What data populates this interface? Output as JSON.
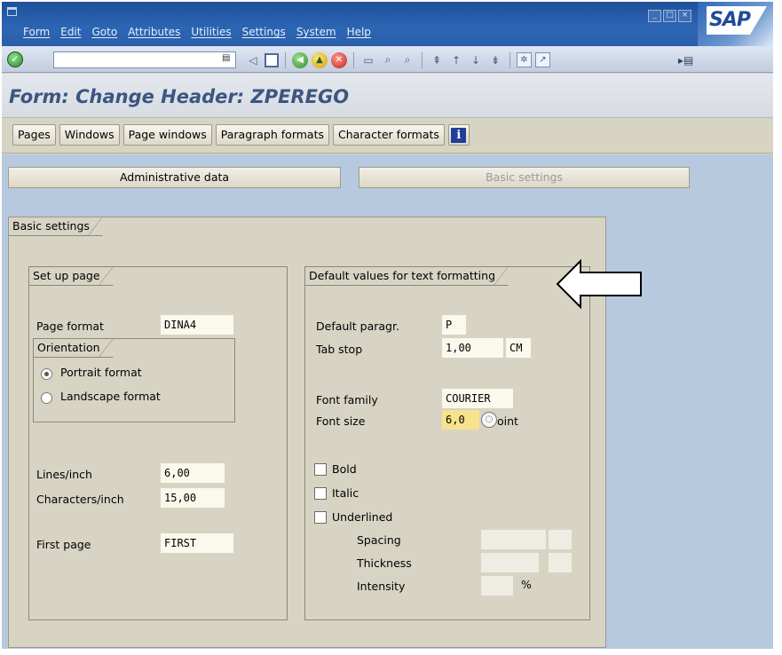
{
  "menu": [
    "Form",
    "Edit",
    "Goto",
    "Attributes",
    "Utilities",
    "Settings",
    "System",
    "Help"
  ],
  "logo": "SAP",
  "page_title": "Form: Change Header: ZPEREGO",
  "app_toolbar": [
    "Pages",
    "Windows",
    "Page windows",
    "Paragraph formats",
    "Character formats"
  ],
  "tabs": {
    "admin": "Administrative data",
    "basic": "Basic settings"
  },
  "panel_title": "Basic settings",
  "setup_page": {
    "title": "Set up page",
    "page_format_label": "Page format",
    "page_format_value": "DINA4",
    "orientation_title": "Orientation",
    "portrait": "Portrait format",
    "landscape": "Landscape format",
    "orientation_selected": "Portrait format",
    "lines_label": "Lines/inch",
    "lines_value": "6,00",
    "chars_label": "Characters/inch",
    "chars_value": "15,00",
    "first_page_label": "First page",
    "first_page_value": "FIRST"
  },
  "text_defaults": {
    "title": "Default values for text formatting",
    "paragr_label": "Default paragr.",
    "paragr_value": "P",
    "tab_label": "Tab stop",
    "tab_value": "1,00",
    "tab_unit": "CM",
    "font_family_label": "Font family",
    "font_family_value": "COURIER",
    "font_size_label": "Font size",
    "font_size_value": "6,0",
    "font_size_unit": "oint",
    "bold": "Bold",
    "italic": "Italic",
    "underlined": "Underlined",
    "spacing": "Spacing",
    "thickness": "Thickness",
    "intensity": "Intensity",
    "intensity_unit": "%"
  },
  "colors": {
    "accent_title": "#3b5680",
    "highlight_field": "#f7e28e",
    "sap_blue": "#2c66b4"
  }
}
